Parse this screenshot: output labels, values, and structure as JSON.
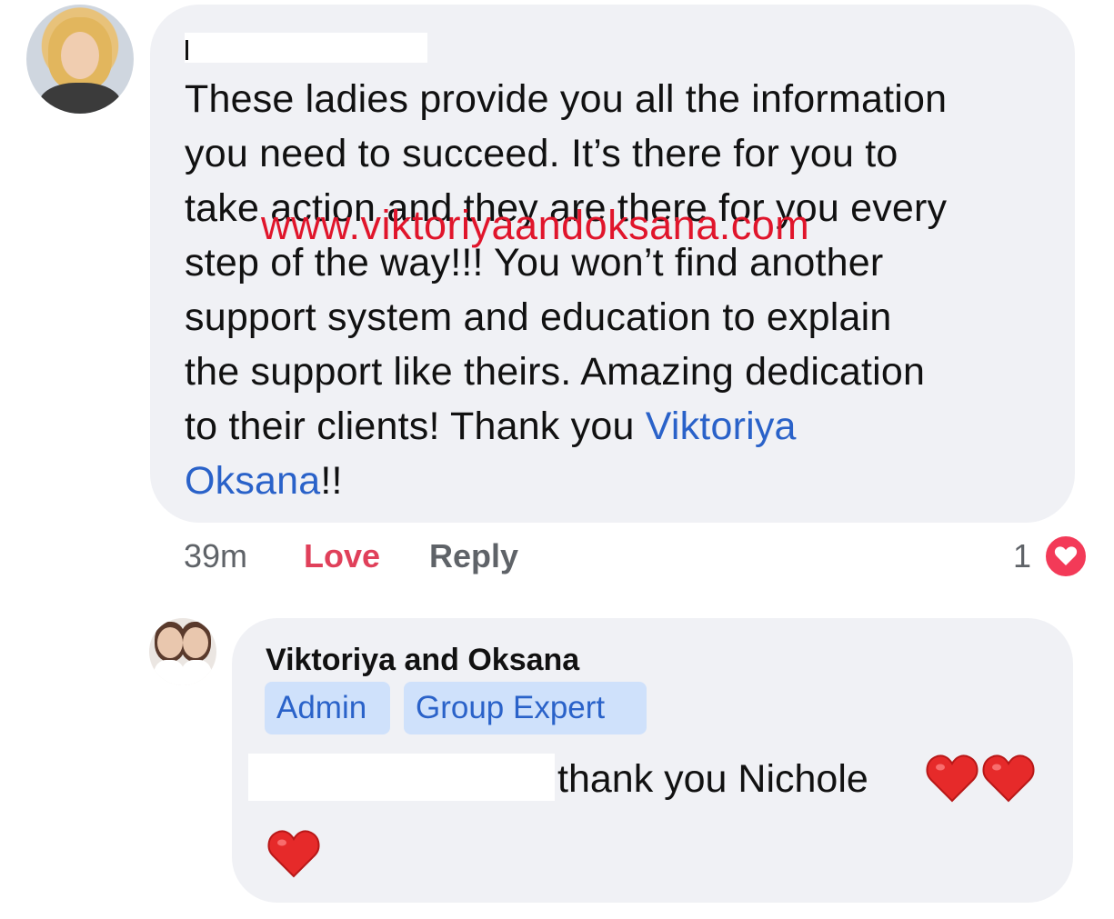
{
  "comment": {
    "body_text": "These ladies provide you all the information\nyou need to succeed.  It’s there for you to\ntake action and they are there for you every\nstep of the way!!!  You won’t find another\nsupport system and education to explain\nthe support like theirs. Amazing dedication\nto their clients!  Thank you  ",
    "mentions": [
      "Viktoriya",
      "Oksana"
    ],
    "ending": "!!",
    "watermark": "www.viktoriyaandoksana.com",
    "time": "39m",
    "love_label": "Love",
    "reply_label": "Reply",
    "reaction_count": "1",
    "reaction_icon": "heart-icon"
  },
  "reply": {
    "author": "Viktoriya and Oksana",
    "badges": [
      "Admin",
      "Group Expert"
    ],
    "text": "thank you Nichole",
    "emoji_icon": "red-heart-emoji"
  },
  "colors": {
    "bubble": "#f0f1f5",
    "mention": "#2a62c9",
    "love": "#e0405a",
    "watermark": "#e0152b",
    "badge_bg": "#cfe1fb",
    "heart": "#f33a58"
  }
}
